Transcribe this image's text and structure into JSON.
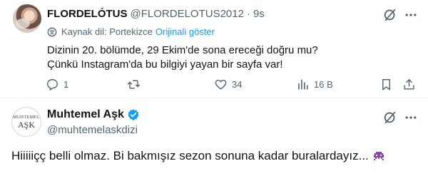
{
  "tweet1": {
    "display_name": "FLORDELÓTUS",
    "handle": "@FLORDELOTUS2012",
    "separator": "·",
    "time": "9s",
    "translation": {
      "source_label": "Kaynak dil: Portekizce",
      "show_original": "Orijinali göster"
    },
    "text_lines": [
      "Dizinin 20. bölümde, 29 Ekim'de sona ereceği doğru mu?",
      "Çünkü Instagram'da bu bilgiyi yayan bir sayfa var!"
    ],
    "actions": {
      "reply_count": "1",
      "retweet_count": "",
      "like_count": "34",
      "views_count": "16 B"
    },
    "icons": [
      "grok-icon",
      "more-icon",
      "translate-icon",
      "reply-icon",
      "retweet-icon",
      "like-icon",
      "views-icon",
      "bookmark-icon",
      "share-icon"
    ]
  },
  "tweet2": {
    "display_name": "Muhtemel Aşk",
    "handle": "@muhtemelaskdizi",
    "avatar_text": [
      "MUHTEMEL",
      "AŞK"
    ],
    "verified": true,
    "text": "Hiiiiiçç belli olmaz. Bi bakmışız sezon sonuna kadar buralardayız...",
    "emoji": "alien-monster-emoji"
  },
  "colors": {
    "text": "#0f1419",
    "secondary": "#536471",
    "accent": "#1d9bf0",
    "divider": "#eff3f4",
    "emoji": "#8e44ad"
  }
}
